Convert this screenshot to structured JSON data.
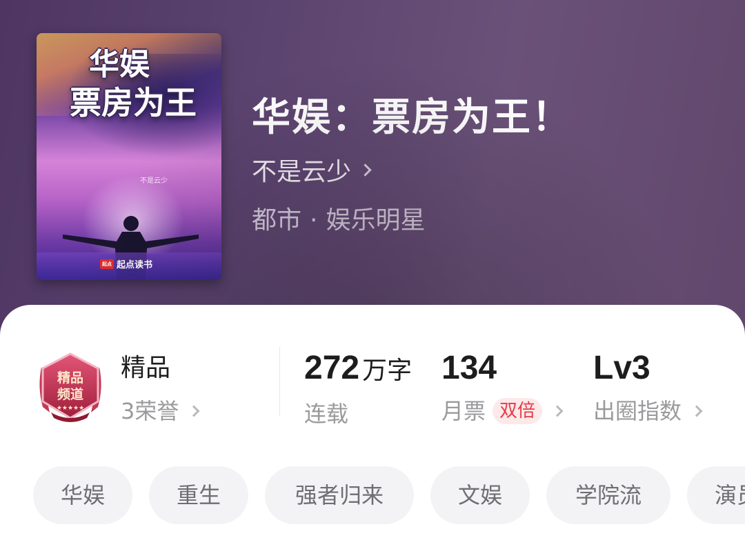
{
  "book": {
    "title": "华娱：票房为王！",
    "author": "不是云少",
    "category": "都市",
    "category_separator": "·",
    "subcategory": "娱乐明星"
  },
  "cover": {
    "title_line1": "华娱",
    "title_line2": "票房为王",
    "author": "不是云少",
    "publisher": "起点读书",
    "publisher_badge": "起点"
  },
  "stats": {
    "quality": {
      "label": "精品",
      "sub": "3荣誉"
    },
    "words": {
      "value": "272",
      "unit": "万字",
      "sub": "连载"
    },
    "monthly_votes": {
      "value": "134",
      "sub": "月票",
      "badge": "双倍"
    },
    "influence": {
      "value": "Lv3",
      "sub": "出圈指数"
    }
  },
  "medal": {
    "line1": "精品",
    "line2": "频道",
    "accent": "#d4395a"
  },
  "tags": [
    "华娱",
    "重生",
    "强者归来",
    "文娱",
    "学院流",
    "演员"
  ],
  "colors": {
    "header_bg": "#5c4470",
    "badge_red": "#e53a45",
    "badge_bg": "#fde9ea"
  }
}
